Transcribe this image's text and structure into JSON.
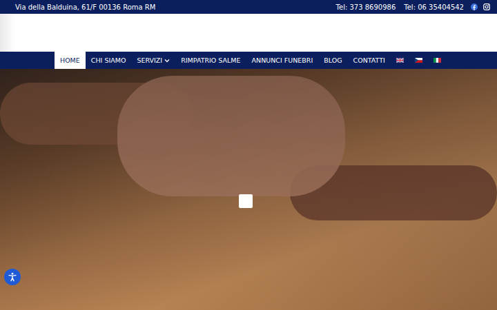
{
  "topbar": {
    "address": "Via della Balduina, 61/F 00136 Roma RM",
    "phones": [
      "Tel: 373 8690986",
      "Tel: 06 35404542"
    ]
  },
  "nav": {
    "items": [
      {
        "label": "HOME",
        "selected": true,
        "dropdown": false
      },
      {
        "label": "CHI SIAMO",
        "selected": false,
        "dropdown": false
      },
      {
        "label": "SERVIZI",
        "selected": false,
        "dropdown": true
      },
      {
        "label": "RIMPATRIO SALME",
        "selected": false,
        "dropdown": false
      },
      {
        "label": "ANNUNCI FUNEBRI",
        "selected": false,
        "dropdown": false
      },
      {
        "label": "BLOG",
        "selected": false,
        "dropdown": false
      },
      {
        "label": "CONTATTI",
        "selected": false,
        "dropdown": false
      }
    ],
    "languages": [
      {
        "kind": "uk"
      },
      {
        "kind": "czech"
      },
      {
        "kind": "italy"
      }
    ]
  }
}
